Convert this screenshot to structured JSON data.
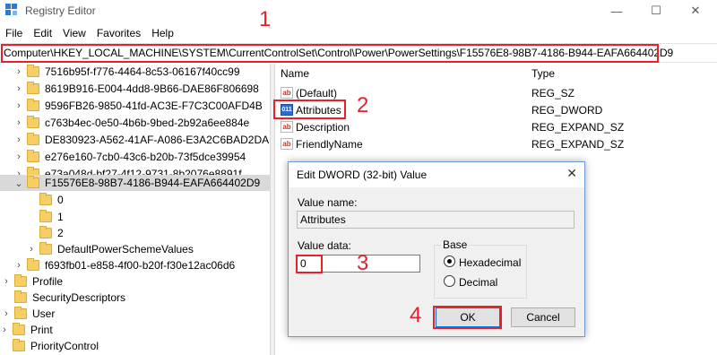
{
  "window": {
    "title": "Registry Editor",
    "minimize_glyph": "—",
    "maximize_glyph": "☐",
    "close_glyph": "✕"
  },
  "menu": [
    "File",
    "Edit",
    "View",
    "Favorites",
    "Help"
  ],
  "address": "Computer\\HKEY_LOCAL_MACHINE\\SYSTEM\\CurrentControlSet\\Control\\Power\\PowerSettings\\F15576E8-98B7-4186-B944-EAFA664402D9",
  "tree": [
    {
      "label": "7516b95f-f776-4464-8c53-06167f40cc99",
      "expander": "›"
    },
    {
      "label": "8619B916-E004-4dd8-9B66-DAE86F806698",
      "expander": "›"
    },
    {
      "label": "9596FB26-9850-41fd-AC3E-F7C3C00AFD4B",
      "expander": "›"
    },
    {
      "label": "c763b4ec-0e50-4b6b-9bed-2b92a6ee884e",
      "expander": "›"
    },
    {
      "label": "DE830923-A562-41AF-A086-E3A2C6BAD2DA",
      "expander": "›"
    },
    {
      "label": "e276e160-7cb0-43c6-b20b-73f5dce39954",
      "expander": "›"
    },
    {
      "label": "e73a048d-bf27-4f12-9731-8b2076e8891f",
      "expander": "›"
    },
    {
      "label": "F15576E8-98B7-4186-B944-EAFA664402D9",
      "expander": "⌄"
    },
    {
      "label": "0",
      "expander": ""
    },
    {
      "label": "1",
      "expander": ""
    },
    {
      "label": "2",
      "expander": ""
    },
    {
      "label": "DefaultPowerSchemeValues",
      "expander": "›"
    },
    {
      "label": "f693fb01-e858-4f00-b20f-f30e12ac06d6",
      "expander": "›"
    },
    {
      "label": "Profile",
      "expander": "›"
    },
    {
      "label": "SecurityDescriptors",
      "expander": ""
    },
    {
      "label": "User",
      "expander": "›"
    },
    {
      "label": "Print",
      "expander": "›"
    },
    {
      "label": "PriorityControl",
      "expander": ""
    }
  ],
  "values_pane": {
    "col_name": "Name",
    "col_type": "Type",
    "rows": [
      {
        "name": "(Default)",
        "type": "REG_SZ",
        "icon": "ab"
      },
      {
        "name": "Attributes",
        "type": "REG_DWORD",
        "icon": "011"
      },
      {
        "name": "Description",
        "type": "REG_EXPAND_SZ",
        "icon": "ab"
      },
      {
        "name": "FriendlyName",
        "type": "REG_EXPAND_SZ",
        "icon": "ab"
      }
    ]
  },
  "dialog": {
    "title": "Edit DWORD (32-bit) Value",
    "value_name_label": "Value name:",
    "value_name": "Attributes",
    "value_data_label": "Value data:",
    "value_data": "0",
    "base_label": "Base",
    "hex_label": "Hexadecimal",
    "dec_label": "Decimal",
    "selected_base": "Hexadecimal",
    "ok_label": "OK",
    "cancel_label": "Cancel"
  },
  "annotations": {
    "step1": "1",
    "step2": "2",
    "step3": "3",
    "step4": "4",
    "highlight_color": "#e8202a"
  }
}
